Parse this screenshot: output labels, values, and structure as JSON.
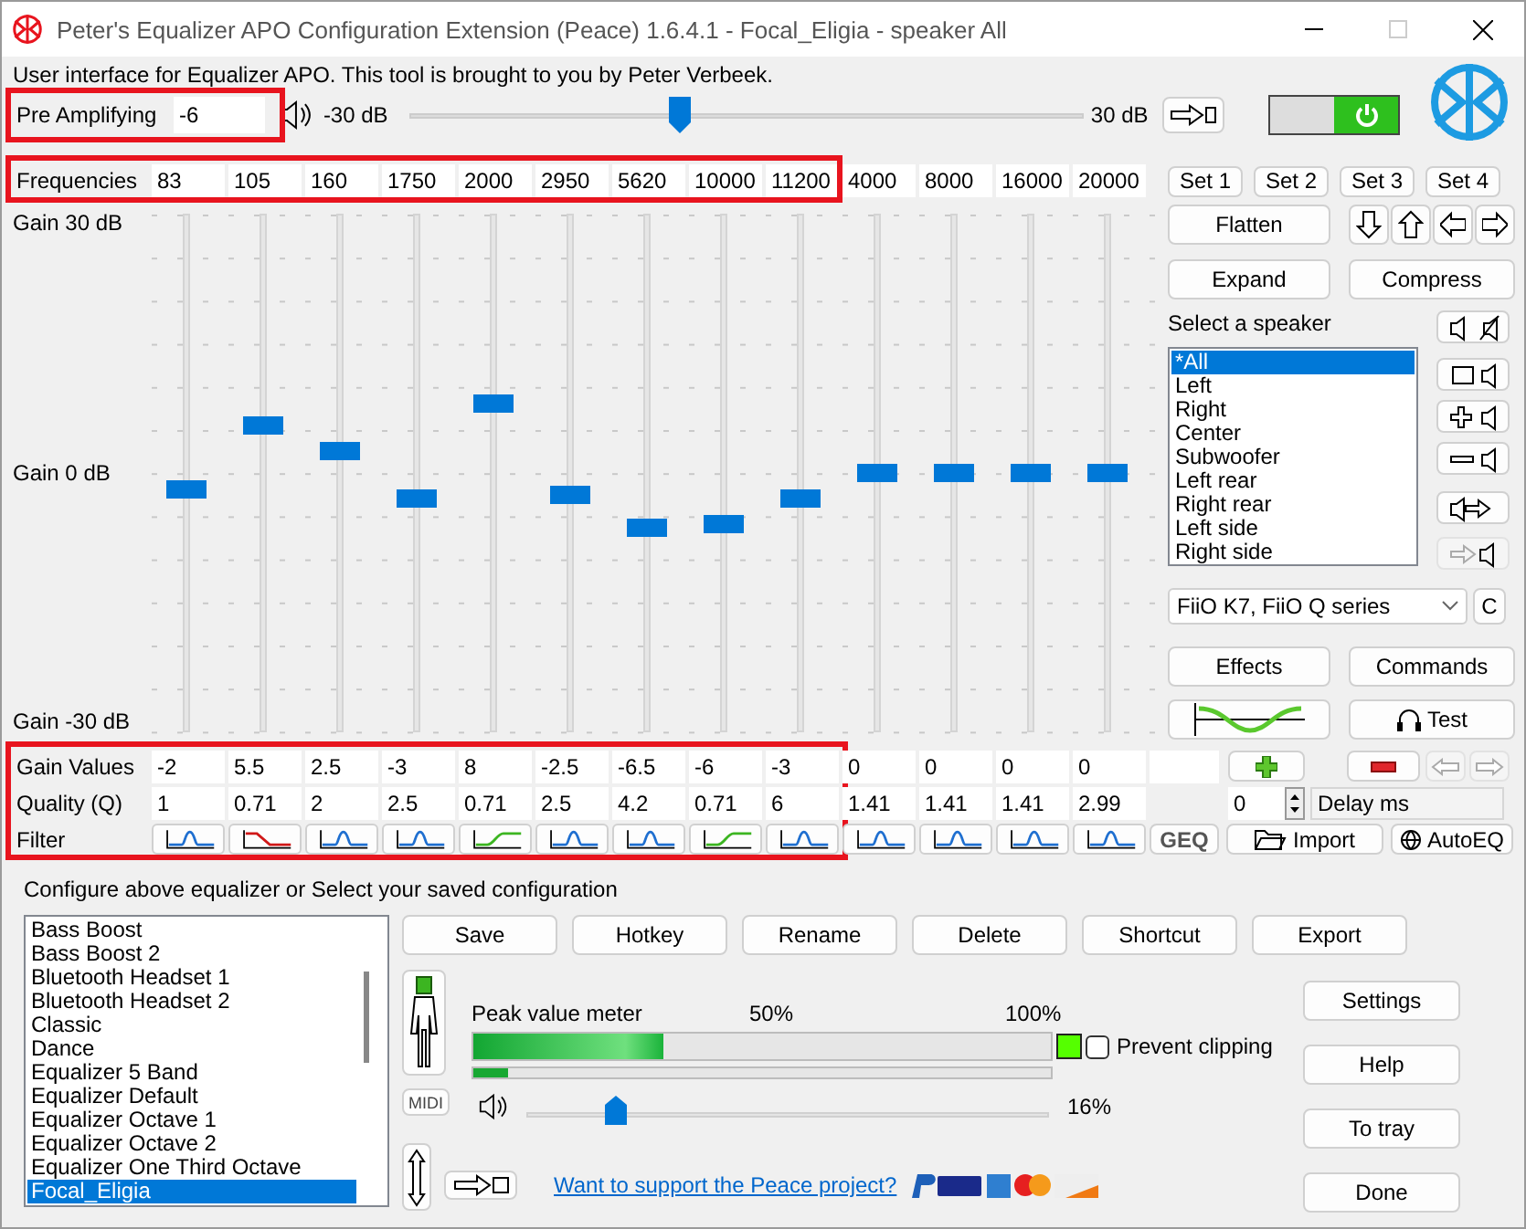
{
  "window": {
    "title": "Peter's Equalizer APO Configuration Extension (Peace) 1.6.4.1 - Focal_Eligia - speaker All",
    "maximize_disabled": true
  },
  "intro": "User interface for Equalizer APO. This tool is brought to you by Peter Verbeek.",
  "pre_amp": {
    "label": "Pre Amplifying",
    "value": "-6",
    "min_label": "-30 dB",
    "max_label": "30 dB",
    "level": 0.4
  },
  "annotations": [
    {
      "kind": "pre_amp"
    },
    {
      "kind": "frequencies"
    },
    {
      "kind": "band_values"
    }
  ],
  "power": {
    "on": true
  },
  "labels": {
    "frequencies": "Frequencies",
    "gain_top": "Gain 30 dB",
    "gain_mid": "Gain 0 dB",
    "gain_bottom": "Gain -30 dB",
    "gain_values": "Gain Values",
    "quality": "Quality (Q)",
    "filter": "Filter"
  },
  "bands": [
    {
      "frequency": "83",
      "gain": "-2",
      "q": "1",
      "filter": {
        "kind": "peak"
      },
      "level": 0.467
    },
    {
      "frequency": "105",
      "gain": "5.5",
      "q": "0.71",
      "filter": {
        "kind": "high_cut"
      },
      "level": 0.592
    },
    {
      "frequency": "160",
      "gain": "2.5",
      "q": "2",
      "filter": {
        "kind": "peak"
      },
      "level": 0.542
    },
    {
      "frequency": "1750",
      "gain": "-3",
      "q": "2.5",
      "filter": {
        "kind": "peak"
      },
      "level": 0.45
    },
    {
      "frequency": "2000",
      "gain": "8",
      "q": "0.71",
      "filter": {
        "kind": "high_shelf"
      },
      "level": 0.633
    },
    {
      "frequency": "2950",
      "gain": "-2.5",
      "q": "2.5",
      "filter": {
        "kind": "peak"
      },
      "level": 0.458
    },
    {
      "frequency": "5620",
      "gain": "-6.5",
      "q": "4.2",
      "filter": {
        "kind": "peak"
      },
      "level": 0.392
    },
    {
      "frequency": "10000",
      "gain": "-6",
      "q": "0.71",
      "filter": {
        "kind": "high_shelf"
      },
      "level": 0.4
    },
    {
      "frequency": "11200",
      "gain": "-3",
      "q": "6",
      "filter": {
        "kind": "peak"
      },
      "level": 0.45
    },
    {
      "frequency": "4000",
      "gain": "0",
      "q": "1.41",
      "filter": {
        "kind": "peak"
      },
      "level": 0.5
    },
    {
      "frequency": "8000",
      "gain": "0",
      "q": "1.41",
      "filter": {
        "kind": "peak"
      },
      "level": 0.5
    },
    {
      "frequency": "16000",
      "gain": "0",
      "q": "1.41",
      "filter": {
        "kind": "peak"
      },
      "level": 0.5
    },
    {
      "frequency": "20000",
      "gain": "0",
      "q": "2.99",
      "filter": {
        "kind": "peak"
      },
      "level": 0.5
    }
  ],
  "sets": [
    "Set 1",
    "Set 2",
    "Set 3",
    "Set 4"
  ],
  "flatten": "Flatten",
  "expand": "Expand",
  "compress": "Compress",
  "speaker_label": "Select a speaker",
  "speakers": [
    {
      "label": "*All",
      "selected": true
    },
    {
      "label": "Left",
      "selected": false
    },
    {
      "label": "Right",
      "selected": false
    },
    {
      "label": "Center",
      "selected": false
    },
    {
      "label": "Subwoofer",
      "selected": false
    },
    {
      "label": "Left rear",
      "selected": false
    },
    {
      "label": "Right rear",
      "selected": false
    },
    {
      "label": "Left side",
      "selected": false
    },
    {
      "label": "Right side",
      "selected": false
    }
  ],
  "speaker_buttons": [
    {
      "kind": "mute",
      "disabled": false
    },
    {
      "kind": "square",
      "disabled": false
    },
    {
      "kind": "plus",
      "disabled": false
    },
    {
      "kind": "minus",
      "disabled": false
    },
    {
      "kind": "out",
      "disabled": false
    },
    {
      "kind": "in",
      "disabled": true
    }
  ],
  "device": {
    "value": "FiiO K7, FiiO Q series",
    "button": "C"
  },
  "effects": "Effects",
  "commands": "Commands",
  "test": "Test",
  "geq": "GEQ",
  "import": "Import",
  "autoeq": "AutoEQ",
  "delay": {
    "value": "0",
    "label": "Delay ms"
  },
  "config_label": "Configure above equalizer or Select your saved configuration",
  "presets": [
    {
      "label": "Bass Boost",
      "selected": false
    },
    {
      "label": "Bass Boost 2",
      "selected": false
    },
    {
      "label": "Bluetooth Headset 1",
      "selected": false
    },
    {
      "label": "Bluetooth Headset 2",
      "selected": false
    },
    {
      "label": "Classic",
      "selected": false
    },
    {
      "label": "Dance",
      "selected": false
    },
    {
      "label": "Equalizer 5 Band",
      "selected": false
    },
    {
      "label": "Equalizer Default",
      "selected": false
    },
    {
      "label": "Equalizer Octave 1",
      "selected": false
    },
    {
      "label": "Equalizer Octave 2",
      "selected": false
    },
    {
      "label": "Equalizer One Third Octave",
      "selected": false
    },
    {
      "label": "Focal_Eligia",
      "selected": true
    }
  ],
  "config_buttons": [
    "Save",
    "Hotkey",
    "Rename",
    "Delete",
    "Shortcut",
    "Export"
  ],
  "midi": "MIDI",
  "meter": {
    "label": "Peak value meter",
    "mid": "50%",
    "max": "100%",
    "level": 0.33,
    "secondary": {
      "level": 0.06
    },
    "clipping": false
  },
  "prevent_clipping": {
    "label": "Prevent clipping",
    "checked": false
  },
  "volume": {
    "level": 0.17,
    "reading": "16%"
  },
  "support_link": "Want to support the Peace project?",
  "side_buttons": [
    "Settings",
    "Help",
    "To tray",
    "Done"
  ]
}
